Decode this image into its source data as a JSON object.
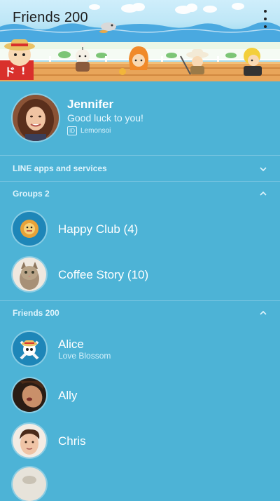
{
  "header": {
    "title": "Friends 200"
  },
  "profile": {
    "name": "Jennifer",
    "status": "Good luck to you!",
    "id_tag": "ID",
    "id_value": "Lemonsoi"
  },
  "sections": {
    "apps": "LINE apps and services",
    "groups": "Groups 2",
    "friends": "Friends 200"
  },
  "groups": [
    {
      "name": "Happy Club (4)"
    },
    {
      "name": "Coffee Story (10)"
    }
  ],
  "friends": [
    {
      "name": "Alice",
      "sub": "Love Blossom"
    },
    {
      "name": "Ally"
    },
    {
      "name": "Chris"
    }
  ],
  "colors": {
    "background": "#4db3d6",
    "banner_sky": "#bfe7f7",
    "deck": "#e8a55a"
  }
}
